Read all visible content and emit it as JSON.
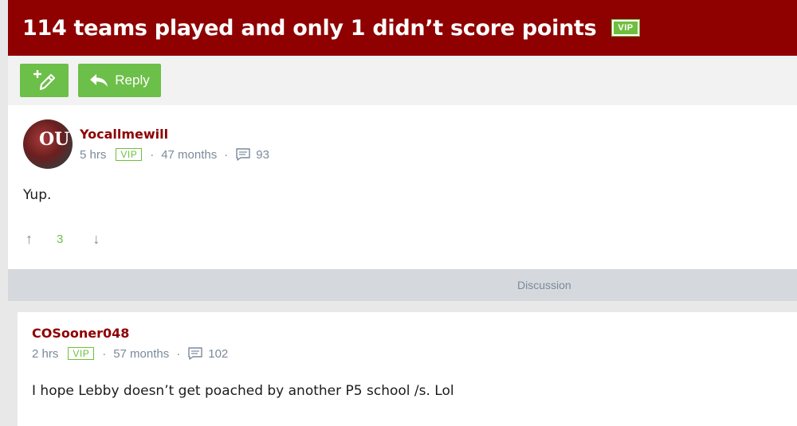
{
  "header": {
    "title": "114 teams played and only 1 didn’t score points",
    "vip_label": "VIP"
  },
  "toolbar": {
    "new_post_icon": "pencil-plus-icon",
    "reply_label": "Reply",
    "reply_icon": "reply-arrow-icon"
  },
  "post1": {
    "username": "Yocallmewill",
    "time": "5 hrs",
    "vip_label": "VIP",
    "membership": "47 months",
    "post_count": "93",
    "body": "Yup.",
    "vote_count": "3"
  },
  "discussion": {
    "label": "Discussion"
  },
  "post2": {
    "username": "COSooner048",
    "time": "2 hrs",
    "vip_label": "VIP",
    "membership": "57 months",
    "post_count": "102",
    "body": "I hope Lebby doesn’t get poached by another P5 school /s. Lol"
  },
  "colors": {
    "brand": "#8f0000",
    "accent": "#6cbf48",
    "muted": "#7a8a9a"
  }
}
